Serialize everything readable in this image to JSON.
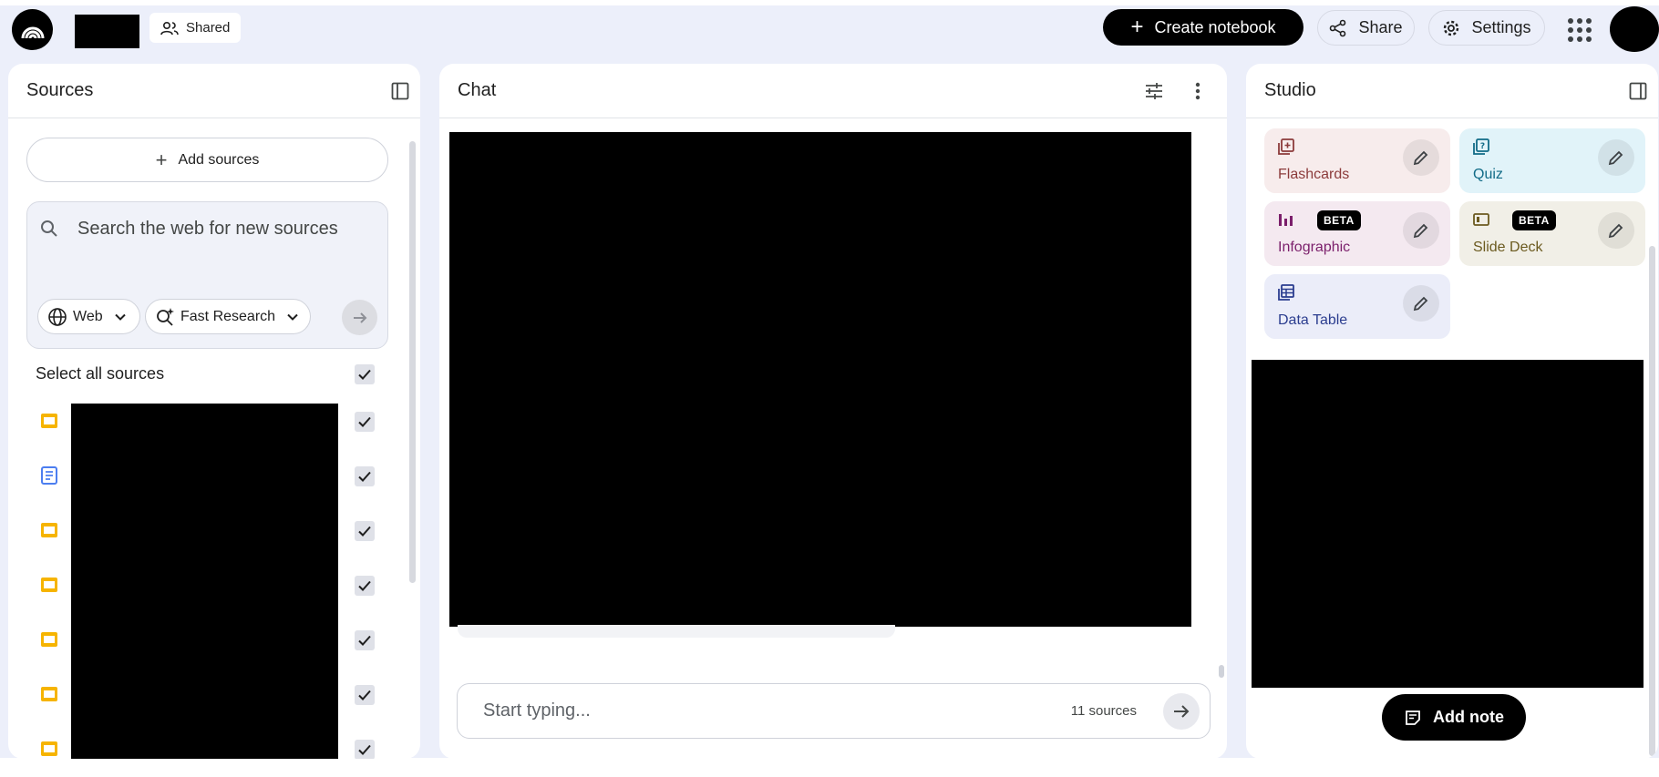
{
  "header": {
    "shared_label": "Shared",
    "create_label": "Create notebook",
    "share_label": "Share",
    "settings_label": "Settings"
  },
  "sources": {
    "title": "Sources",
    "add_label": "Add sources",
    "search_placeholder": "Search the web for new sources",
    "web_chip": "Web",
    "research_chip": "Fast Research",
    "select_all_label": "Select all sources",
    "items": [
      {
        "icon": "slides-icon",
        "color": "#f6b400",
        "checked": true
      },
      {
        "icon": "document-icon",
        "color": "#4c7ef0",
        "checked": true
      },
      {
        "icon": "slides-icon",
        "color": "#f6b400",
        "checked": true
      },
      {
        "icon": "slides-icon",
        "color": "#f6b400",
        "checked": true
      },
      {
        "icon": "slides-icon",
        "color": "#f6b400",
        "checked": true
      },
      {
        "icon": "slides-icon",
        "color": "#f6b400",
        "checked": true
      },
      {
        "icon": "slides-icon",
        "color": "#f6b400",
        "checked": true
      }
    ]
  },
  "chat": {
    "title": "Chat",
    "input_placeholder": "Start typing...",
    "source_count": "11 sources"
  },
  "studio": {
    "title": "Studio",
    "cards": [
      {
        "label": "Flashcards",
        "bg": "#f7ecec",
        "fg": "#8c3b3b"
      },
      {
        "label": "Quiz",
        "bg": "#e1f3f9",
        "fg": "#116b87"
      },
      {
        "label": "Infographic",
        "bg": "#f4e9f0",
        "fg": "#7b1f6b",
        "badge": "BETA"
      },
      {
        "label": "Slide Deck",
        "bg": "#f1efe7",
        "fg": "#6b5a1f",
        "badge": "BETA"
      },
      {
        "label": "Data Table",
        "bg": "#ebedf9",
        "fg": "#2b3d8f"
      }
    ],
    "add_note_label": "Add note"
  }
}
